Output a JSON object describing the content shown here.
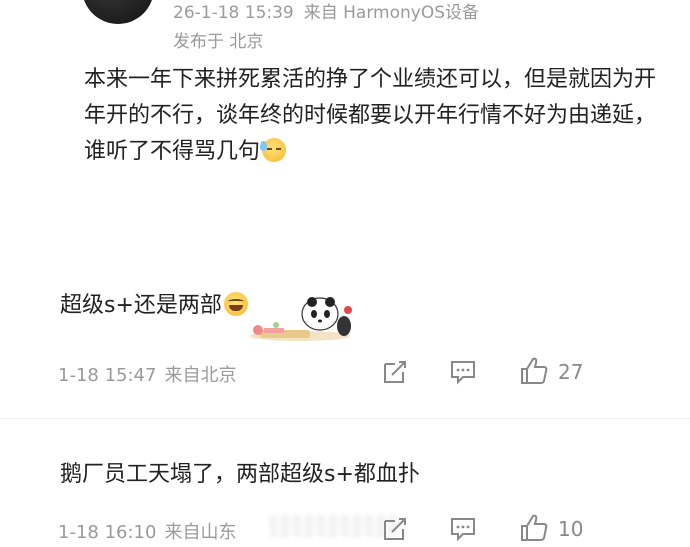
{
  "post": {
    "time": "26-1-18 15:39",
    "source": "来自 HarmonyOS设备",
    "location": "发布于 北京",
    "text": "本来一年下来拼死累活的挣了个业绩还可以，但是就因为开年开的不行，谈年终的时候都要以开年行情不好为由递延，谁听了不得骂几句",
    "emoji": "sweat-smile-icon"
  },
  "comments": [
    {
      "text": "超级s+还是两部",
      "emoji": "laugh-tears-icon",
      "sticker": "panda-sticker",
      "time": "1-18 15:47",
      "source": "来自北京",
      "likes": "27"
    },
    {
      "text": "鹅厂员工天塌了，两部超级s+都血扑",
      "time": "1-18 16:10",
      "source": "来自山东",
      "likes": "10"
    }
  ],
  "icons": {
    "share": "share-icon",
    "comment": "comment-icon",
    "like": "thumbs-up-icon"
  },
  "colors": {
    "text": "#222222",
    "meta": "#9a9a9a",
    "icon": "#888888"
  }
}
